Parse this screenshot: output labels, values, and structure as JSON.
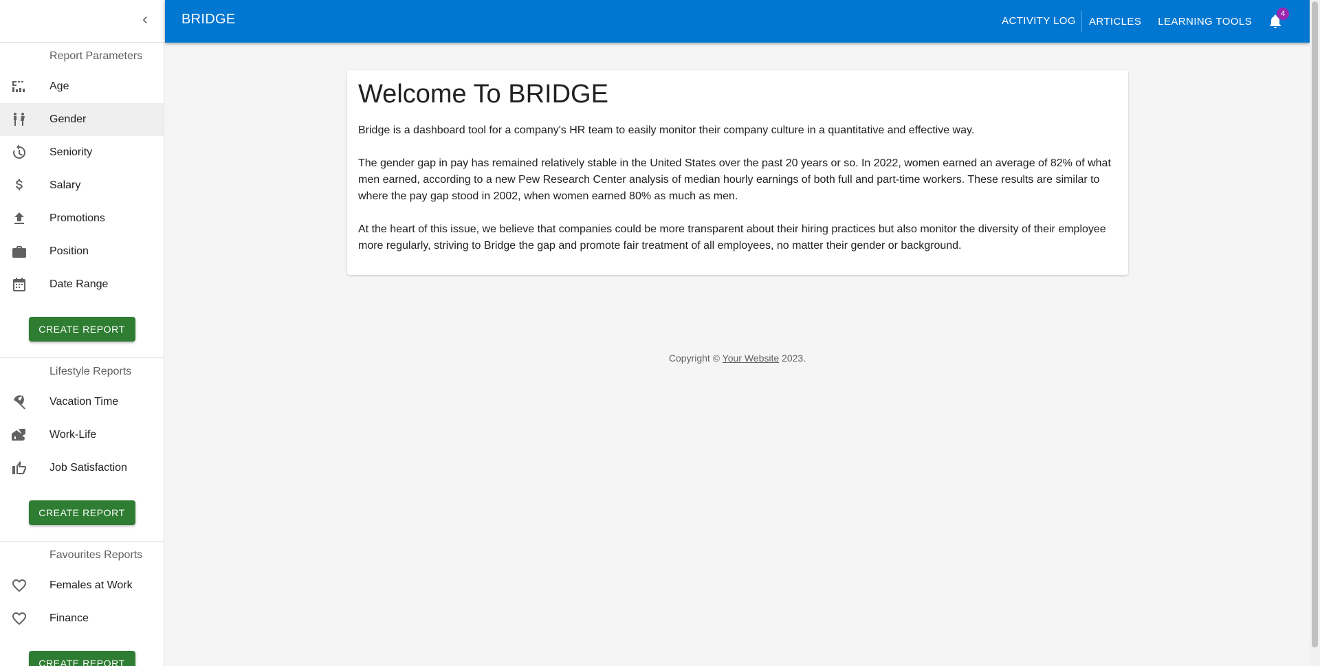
{
  "app": {
    "title": "BRIDGE"
  },
  "topnav": {
    "links": [
      "ACTIVITY LOG",
      "ARTICLES",
      "LEARNING TOOLS"
    ],
    "notification_count": "4"
  },
  "sidebar": {
    "sections": [
      {
        "header": "Report Parameters",
        "items": [
          {
            "label": "Age",
            "icon": "age-icon"
          },
          {
            "label": "Gender",
            "icon": "gender-icon",
            "active": true
          },
          {
            "label": "Seniority",
            "icon": "history-icon"
          },
          {
            "label": "Salary",
            "icon": "dollar-icon"
          },
          {
            "label": "Promotions",
            "icon": "upload-icon"
          },
          {
            "label": "Position",
            "icon": "briefcase-icon"
          },
          {
            "label": "Date Range",
            "icon": "calendar-icon"
          }
        ],
        "button": "CREATE REPORT"
      },
      {
        "header": "Lifestyle Reports",
        "items": [
          {
            "label": "Vacation Time",
            "icon": "beach-umbrella-icon"
          },
          {
            "label": "Work-Life",
            "icon": "home-work-icon"
          },
          {
            "label": "Job Satisfaction",
            "icon": "thumbs-up-icon"
          }
        ],
        "button": "CREATE REPORT"
      },
      {
        "header": "Favourites Reports",
        "items": [
          {
            "label": "Females at Work",
            "icon": "heart-icon"
          },
          {
            "label": "Finance",
            "icon": "heart-icon"
          }
        ],
        "button": "CREATE REPORT"
      }
    ]
  },
  "main": {
    "heading": "Welcome To BRIDGE",
    "paragraphs": [
      "Bridge is a dashboard tool for a company's HR team to easily monitor their company culture in a quantitative and effective way.",
      "The gender gap in pay has remained relatively stable in the United States over the past 20 years or so. In 2022, women earned an average of 82% of what men earned, according to a new Pew Research Center analysis of median hourly earnings of both full and part-time workers. These results are similar to where the pay gap stood in 2002, when women earned 80% as much as men.",
      "At the heart of this issue, we believe that companies could be more transparent about their hiring practices but also monitor the diversity of their employee more regularly, striving to Bridge the gap and promote fair treatment of all employees, no matter their gender or background."
    ]
  },
  "footer": {
    "prefix": "Copyright © ",
    "link": "Your Website",
    "suffix": " 2023."
  },
  "colors": {
    "appbar": "#0277d1",
    "button": "#2e7d32",
    "badge": "#9c27b0"
  }
}
